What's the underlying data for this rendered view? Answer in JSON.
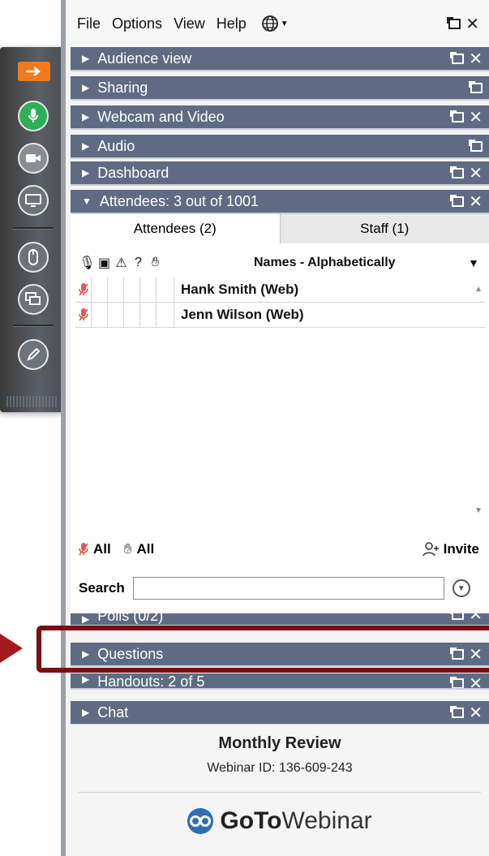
{
  "menu": {
    "file": "File",
    "options": "Options",
    "view": "View",
    "help": "Help"
  },
  "panels": {
    "audience": "Audience view",
    "sharing": "Sharing",
    "webcam": "Webcam and Video",
    "audio": "Audio",
    "dashboard": "Dashboard",
    "attendees": "Attendees:  3 out of 1001",
    "polls": "Polls (0/2)",
    "questions": "Questions",
    "handouts": "Handouts: 2 of 5",
    "chat": "Chat"
  },
  "attendees": {
    "tabs": [
      "Attendees (2)",
      "Staff (1)"
    ],
    "sort_label": "Names - Alphabetically",
    "rows": [
      {
        "name": "Hank Smith (Web)"
      },
      {
        "name": "Jenn Wilson (Web)"
      }
    ],
    "mute_all": "All",
    "raise_all": "All",
    "invite": "Invite",
    "search_label": "Search",
    "search_value": ""
  },
  "footer": {
    "title": "Monthly Review",
    "webinar_id": "Webinar ID: 136-609-243",
    "brand_bold": "GoTo",
    "brand_rest": "Webinar"
  },
  "colors": {
    "panel_bar": "#5e6b83",
    "accent": "#f07a1c",
    "mic_green": "#2fae5a",
    "highlight": "#7a0f12"
  }
}
